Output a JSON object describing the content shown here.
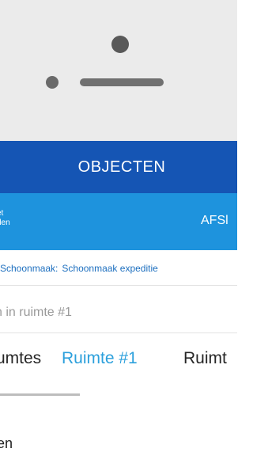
{
  "app": {
    "title": "OBJECTEN"
  },
  "toolbar": {
    "left_line1": "et",
    "left_line2": "den",
    "right_action": "AFSl"
  },
  "breadcrumb": {
    "item1": "Schoonmaak:",
    "item2": "Schoonmaak expeditie"
  },
  "search": {
    "placeholder": "n in ruimte #1"
  },
  "tabs": [
    {
      "label": "umtes"
    },
    {
      "label": "Ruimte #1"
    },
    {
      "label": "Ruimt"
    }
  ],
  "list": {
    "first_item": "en"
  },
  "colors": {
    "appbar": "#1555b4",
    "subbar": "#1e93dd",
    "active_tab": "#2ca0dc",
    "bezel": "#ebebeb"
  }
}
